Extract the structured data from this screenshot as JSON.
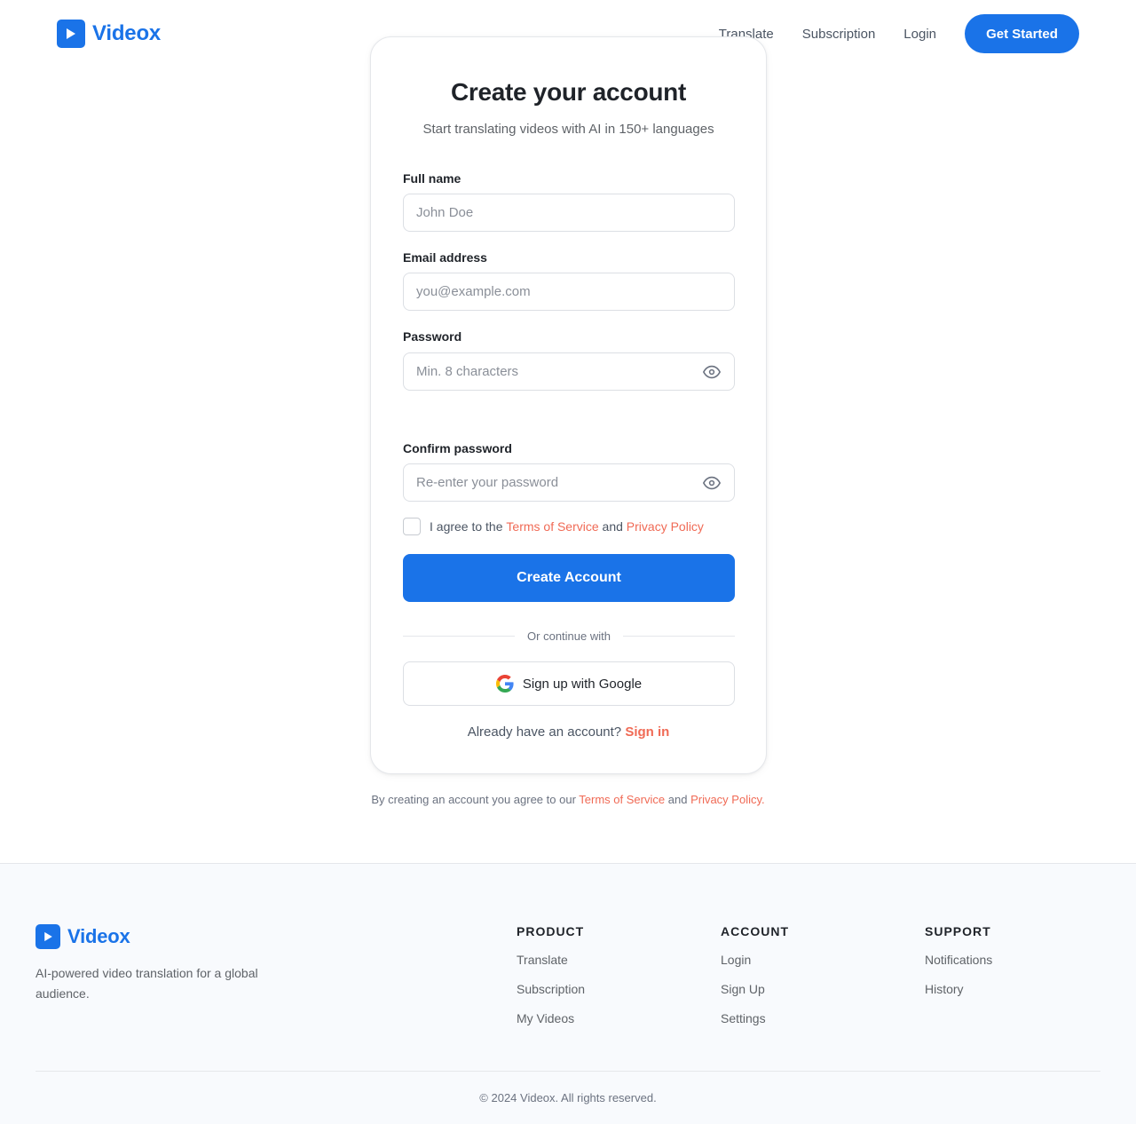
{
  "header": {
    "brand": "Videox",
    "nav": [
      "Translate",
      "Subscription",
      "Login"
    ],
    "cta": "Get Started"
  },
  "signup": {
    "title": "Create your account",
    "subtitle": "Start translating videos with AI in 150+ languages",
    "fields": {
      "full_name": {
        "label": "Full name",
        "placeholder": "John Doe",
        "value": ""
      },
      "email": {
        "label": "Email address",
        "placeholder": "you@example.com",
        "value": ""
      },
      "password": {
        "label": "Password",
        "placeholder": "Min. 8 characters",
        "value": ""
      },
      "confirm_password": {
        "label": "Confirm password",
        "placeholder": "Re-enter your password",
        "value": ""
      }
    },
    "agree": {
      "prefix": "I agree to the",
      "terms": "Terms of Service",
      "and": "and",
      "privacy": "Privacy Policy",
      "checked": false
    },
    "submit": "Create Account",
    "divider": "Or continue with",
    "google": "Sign up with Google",
    "already": "Already have an account?",
    "signin": "Sign in"
  },
  "legal": {
    "prefix": "By creating an account you agree to our",
    "terms": "Terms of Service",
    "and": "and",
    "privacy": "Privacy Policy",
    "suffix": "."
  },
  "footer": {
    "brand": "Videox",
    "description": "AI-powered video translation for a global audience.",
    "columns": [
      {
        "title": "PRODUCT",
        "links": [
          "Translate",
          "Subscription",
          "My Videos"
        ]
      },
      {
        "title": "ACCOUNT",
        "links": [
          "Login",
          "Sign Up",
          "Settings"
        ]
      },
      {
        "title": "SUPPORT",
        "links": [
          "Notifications",
          "History"
        ]
      }
    ],
    "copyright": "© 2024 Videox. All rights reserved."
  },
  "colors": {
    "primary": "#1a73e8",
    "link_accent": "#f06a55",
    "footer_bg": "#f8fafd"
  },
  "icons": [
    "play-icon",
    "eye-icon",
    "google-icon"
  ]
}
